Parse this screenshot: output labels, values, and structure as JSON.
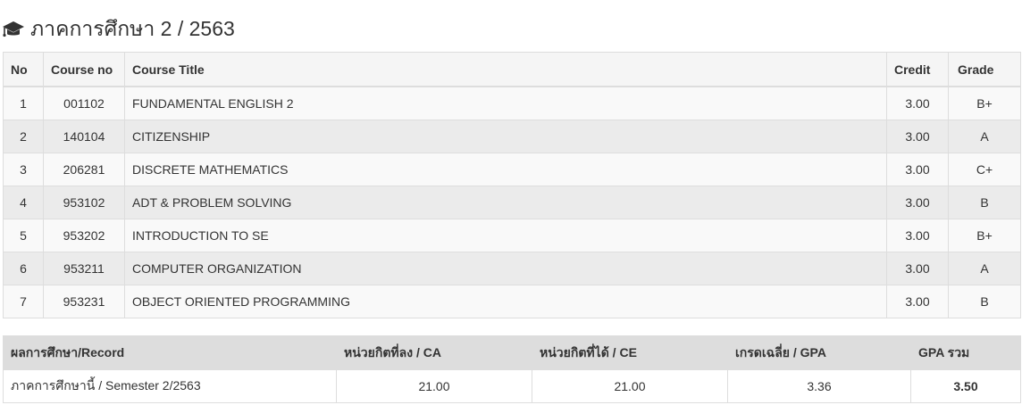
{
  "semester_title": "ภาคการศึกษา 2 / 2563",
  "heading_icon": "graduation-cap-icon",
  "courses": {
    "headers": {
      "no": "No",
      "code": "Course no",
      "title": "Course Title",
      "credit": "Credit",
      "grade": "Grade"
    },
    "rows": [
      {
        "no": "1",
        "code": "001102",
        "title": "FUNDAMENTAL ENGLISH 2",
        "credit": "3.00",
        "grade": "B+"
      },
      {
        "no": "2",
        "code": "140104",
        "title": "CITIZENSHIP",
        "credit": "3.00",
        "grade": "A"
      },
      {
        "no": "3",
        "code": "206281",
        "title": "DISCRETE MATHEMATICS",
        "credit": "3.00",
        "grade": "C+"
      },
      {
        "no": "4",
        "code": "953102",
        "title": "ADT & PROBLEM SOLVING",
        "credit": "3.00",
        "grade": "B"
      },
      {
        "no": "5",
        "code": "953202",
        "title": "INTRODUCTION TO SE",
        "credit": "3.00",
        "grade": "B+"
      },
      {
        "no": "6",
        "code": "953211",
        "title": "COMPUTER ORGANIZATION",
        "credit": "3.00",
        "grade": "A"
      },
      {
        "no": "7",
        "code": "953231",
        "title": "OBJECT ORIENTED PROGRAMMING",
        "credit": "3.00",
        "grade": "B"
      }
    ]
  },
  "summary": {
    "headers": {
      "record": "ผลการศึกษา/Record",
      "ca": "หน่วยกิตที่ลง / CA",
      "ce": "หน่วยกิตที่ได้ / CE",
      "gpa": "เกรดเฉลี่ย / GPA",
      "gpa_total": "GPA รวม"
    },
    "row": {
      "label": "ภาคการศึกษานี้ / Semester 2/2563",
      "ca": "21.00",
      "ce": "21.00",
      "gpa": "3.36",
      "gpa_total": "3.50"
    }
  }
}
